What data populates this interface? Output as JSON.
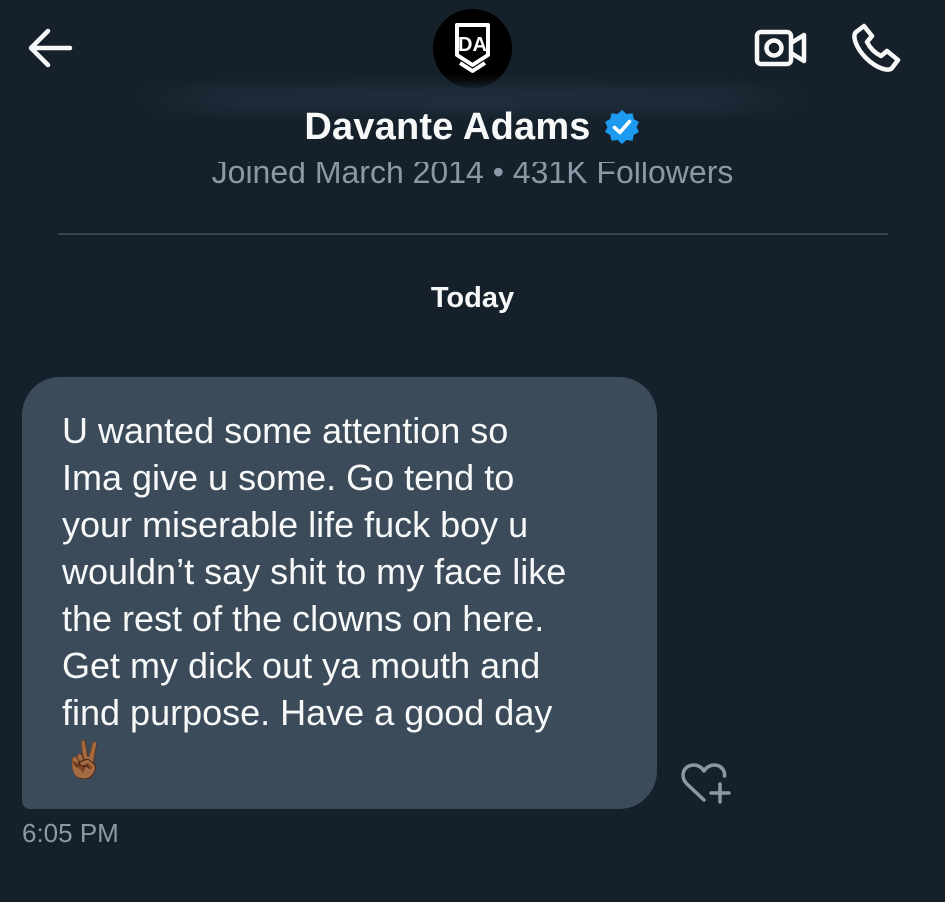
{
  "header": {
    "back_icon": "arrow-left-icon",
    "avatar_logo_text": "DA",
    "video_icon": "video-camera-icon",
    "phone_icon": "phone-icon",
    "name": "Davante Adams",
    "verified_icon": "verified-badge-icon",
    "verified_color": "#1d9bf0",
    "subtitle": "Joined March 2014 • 431K Followers"
  },
  "conversation": {
    "day_label": "Today",
    "messages": [
      {
        "text": "U wanted some attention so\nIma give u some. Go tend to\nyour miserable life fuck boy u\nwouldn’t say shit to my face like\nthe rest of the clowns on here.\nGet my dick out ya mouth and\nfind purpose. Have a good day\n✌🏾",
        "time": "6:05 PM",
        "react_icon": "heart-plus-icon"
      }
    ]
  },
  "colors": {
    "background": "#15202b",
    "bubble": "#3c4b5a",
    "muted_text": "#8b98a5",
    "divider": "#38444d"
  }
}
